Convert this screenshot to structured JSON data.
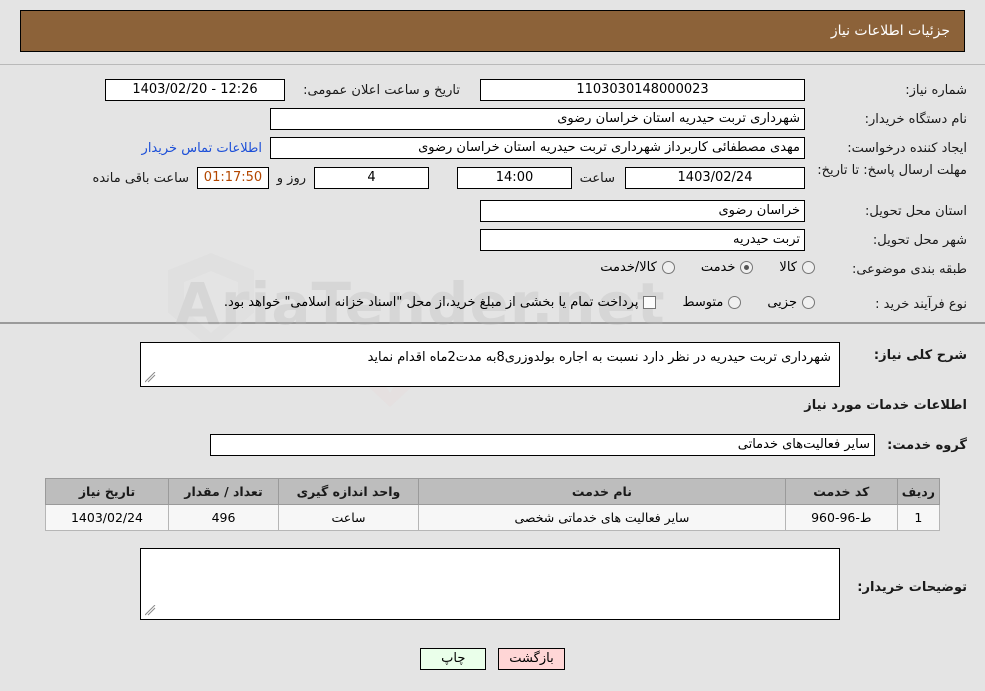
{
  "header": {
    "title": "جزئیات اطلاعات نیاز"
  },
  "top": {
    "need_number_label": "شماره نیاز:",
    "need_number_value": "1103030148000023",
    "announce_datetime_label": "تاریخ و ساعت اعلان عمومی:",
    "announce_datetime_value": "12:26 - 1403/02/20",
    "buyer_org_label": "نام دستگاه خریدار:",
    "buyer_org_value": "شهرداری تربت حیدریه استان خراسان رضوی",
    "requester_label": "ایجاد کننده درخواست:",
    "requester_value": "مهدی مصطفائی کاربرداز شهرداری تربت حیدریه استان خراسان رضوی",
    "buyer_contact_link": "اطلاعات تماس خریدار",
    "deadline_label": "مهلت ارسال پاسخ: تا تاریخ:",
    "deadline_date": "1403/02/24",
    "hour_label": "ساعت",
    "deadline_time": "14:00",
    "days_value": "4",
    "days_unit_label": "روز و",
    "countdown_value": "01:17:50",
    "countdown_suffix": "ساعت باقی مانده",
    "province_label": "استان محل تحویل:",
    "province_value": "خراسان رضوی",
    "city_label": "شهر محل تحویل:",
    "city_value": "تربت حیدریه",
    "category_label": "طبقه بندی موضوعی:",
    "category_options": [
      {
        "label": "کالا",
        "selected": false
      },
      {
        "label": "خدمت",
        "selected": true
      },
      {
        "label": "کالا/خدمت",
        "selected": false
      }
    ],
    "purchase_type_label": "نوع فرآیند خرید :",
    "purchase_type_options": [
      {
        "label": "جزیی",
        "selected": false
      },
      {
        "label": "متوسط",
        "selected": false
      }
    ],
    "treasury_checkbox_label": "پرداخت تمام یا بخشی از مبلغ خرید،از محل \"اسناد خزانه اسلامی\" خواهد بود.",
    "treasury_checked": false
  },
  "middle": {
    "general_desc_label": "شرح کلی نیاز:",
    "general_desc_value": "شهرداری تربت حیدریه در نظر دارد نسبت به اجاره بولدوزری8به مدت2ماه اقدام نماید",
    "services_section_title": "اطلاعات خدمات مورد نیاز",
    "service_group_label": "گروه خدمت:",
    "service_group_value": "سایر فعالیت‌های خدماتی"
  },
  "table": {
    "headers": [
      "ردیف",
      "کد خدمت",
      "نام خدمت",
      "واحد اندازه گیری",
      "تعداد / مقدار",
      "تاریخ نیاز"
    ],
    "rows": [
      {
        "row_no": "1",
        "service_code": "ط-96-960",
        "service_name": "سایر فعالیت های خدماتی شخصی",
        "unit": "ساعت",
        "quantity": "496",
        "need_date": "1403/02/24"
      }
    ]
  },
  "buyer_notes": {
    "label": "توضیحات خریدار:",
    "value": ""
  },
  "footer": {
    "print_label": "چاپ",
    "back_label": "بازگشت"
  },
  "watermark": {
    "text": "AriaTender.net"
  },
  "colors": {
    "header_bg": "#8c6239",
    "link": "#1c4fd8",
    "table_header_bg": "#bdbdbd",
    "print_btn_bg": "#eaffea",
    "back_btn_bg": "#ffd6d6"
  }
}
